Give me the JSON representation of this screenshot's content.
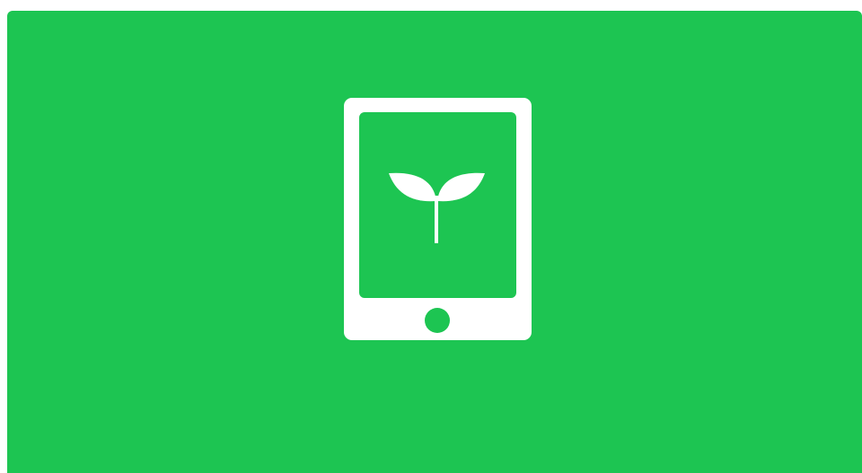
{
  "colors": {
    "background": "#1dc552",
    "icon": "#ffffff"
  },
  "illustration": {
    "device_icon": "tablet-icon",
    "content_icon": "sprout-icon",
    "button_icon": "home-button-icon"
  }
}
